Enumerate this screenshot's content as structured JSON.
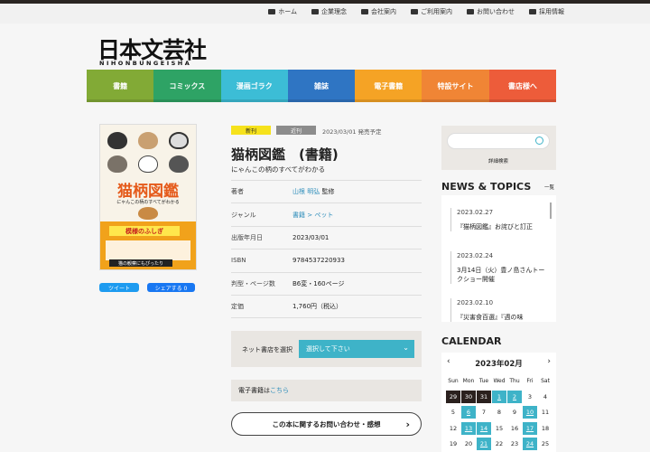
{
  "utility_links": [
    {
      "label": "ホーム",
      "icon": "home-icon"
    },
    {
      "label": "企業理念",
      "icon": "book-icon"
    },
    {
      "label": "会社案内",
      "icon": "building-icon"
    },
    {
      "label": "ご利用案内",
      "icon": "info-icon"
    },
    {
      "label": "お問い合わせ",
      "icon": "mail-icon"
    },
    {
      "label": "採用情報",
      "icon": "briefcase-icon"
    }
  ],
  "logo": {
    "main": "日本文芸社",
    "sub": "NIHONBUNGEISHA"
  },
  "nav": [
    {
      "label": "書籍",
      "color": "#82aa36"
    },
    {
      "label": "コミックス",
      "color": "#2ea365"
    },
    {
      "label": "漫画ゴラク",
      "color": "#3cbdd6"
    },
    {
      "label": "雑誌",
      "color": "#2f75c3"
    },
    {
      "label": "電子書籍",
      "color": "#f5a325"
    },
    {
      "label": "特設サイト",
      "color": "#f08535"
    },
    {
      "label": "書店様へ",
      "color": "#ed5c3a"
    }
  ],
  "cover": {
    "title": "猫柄図鑑",
    "subtitle": "にゃんこの柄のすべてがわかる",
    "banner": "模様のふしぎ",
    "banner2": "猫の観察にもぴったり"
  },
  "share": {
    "tweet": "ツイート",
    "facebook": "シェアする 0"
  },
  "badges": {
    "new": "新刊",
    "recent": "近刊",
    "release": "2023/03/01 発売予定"
  },
  "book": {
    "title": "猫柄図鑑　(書籍)",
    "subtitle": "にゃんこの柄のすべてがわかる",
    "rows": [
      {
        "key": "著者",
        "value": "山根 明弘",
        "suffix": " 監修",
        "link": true
      },
      {
        "key": "ジャンル",
        "value": "書籍",
        "suffix": " > ペット",
        "link": true
      },
      {
        "key": "出版年月日",
        "value": "2023/03/01",
        "suffix": "",
        "link": false
      },
      {
        "key": "ISBN",
        "value": "9784537220933",
        "suffix": "",
        "link": false
      },
      {
        "key": "判型・ページ数",
        "value": "B6変・160ページ",
        "suffix": "",
        "link": false
      },
      {
        "key": "定価",
        "value": "1,760円（税込）",
        "suffix": "",
        "link": false
      }
    ]
  },
  "buy": {
    "label": "ネット書店を選択",
    "select": "選択して下さい"
  },
  "ebook": {
    "prefix": "電子書籍は",
    "link": "こちら"
  },
  "contact": {
    "label": "この本に関するお問い合わせ・感想"
  },
  "search": {
    "advanced": "詳細検索"
  },
  "news": {
    "heading": "NEWS & TOPICS",
    "all": "一覧",
    "items": [
      {
        "date": "2023.02.27",
        "text": "『猫柄図鑑』お詫びと訂正"
      },
      {
        "date": "2023.02.24",
        "text": "3月14日（火）豊ノ島さんトークショー開催"
      },
      {
        "date": "2023.02.10",
        "text": "『災害食百選』『週の味"
      }
    ]
  },
  "calendar": {
    "heading": "CALENDAR",
    "month": "2023年02月",
    "weekdays": [
      "Sun",
      "Mon",
      "Tue",
      "Wed",
      "Thu",
      "Fri",
      "Sat"
    ],
    "days": [
      {
        "d": "29",
        "t": "p"
      },
      {
        "d": "30",
        "t": "p"
      },
      {
        "d": "31",
        "t": "p"
      },
      {
        "d": "1",
        "t": "h"
      },
      {
        "d": "2",
        "t": "h"
      },
      {
        "d": "3",
        "t": ""
      },
      {
        "d": "4",
        "t": ""
      },
      {
        "d": "5",
        "t": ""
      },
      {
        "d": "6",
        "t": "h"
      },
      {
        "d": "7",
        "t": ""
      },
      {
        "d": "8",
        "t": ""
      },
      {
        "d": "9",
        "t": ""
      },
      {
        "d": "10",
        "t": "h"
      },
      {
        "d": "11",
        "t": ""
      },
      {
        "d": "12",
        "t": ""
      },
      {
        "d": "13",
        "t": "h"
      },
      {
        "d": "14",
        "t": "h"
      },
      {
        "d": "15",
        "t": ""
      },
      {
        "d": "16",
        "t": ""
      },
      {
        "d": "17",
        "t": "h"
      },
      {
        "d": "18",
        "t": ""
      },
      {
        "d": "19",
        "t": ""
      },
      {
        "d": "20",
        "t": ""
      },
      {
        "d": "21",
        "t": "h"
      },
      {
        "d": "22",
        "t": ""
      },
      {
        "d": "23",
        "t": ""
      },
      {
        "d": "24",
        "t": "h"
      },
      {
        "d": "25",
        "t": ""
      }
    ]
  }
}
